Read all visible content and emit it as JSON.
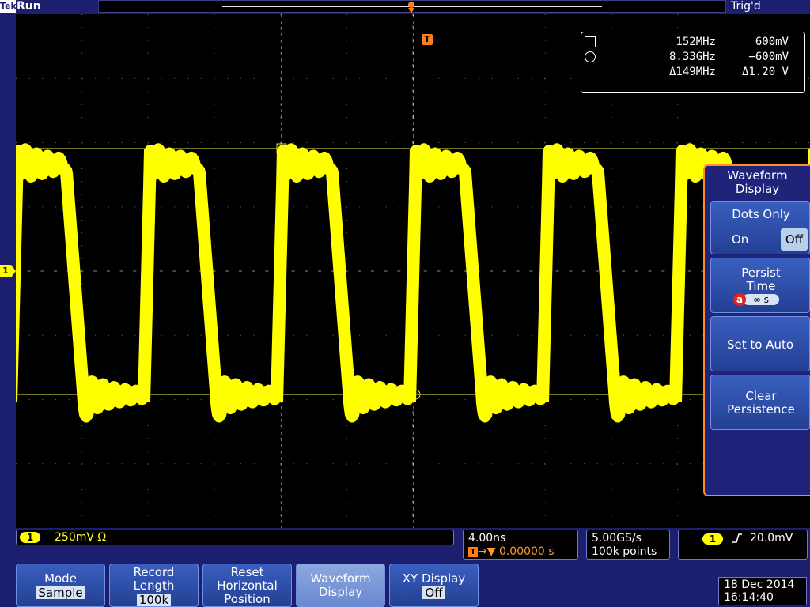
{
  "top": {
    "brand": "Tek",
    "run_status": "Run",
    "trigger_status": "Trig'd"
  },
  "graticule": {
    "trigger_marker": "T",
    "channel_marker": "1"
  },
  "cursor_readout": {
    "rows": [
      {
        "symbol": "square-icon",
        "freq": "152MHz",
        "volt": "600mV"
      },
      {
        "symbol": "circle-icon",
        "freq": "8.33GHz",
        "volt": "−600mV"
      },
      {
        "symbol": "",
        "freq": "Δ149MHz",
        "volt": "Δ1.20 V"
      }
    ]
  },
  "side_menu": {
    "title": "Waveform Display",
    "dots_only": {
      "label": "Dots Only",
      "on": "On",
      "off": "Off",
      "selected": "Off"
    },
    "persist_time": {
      "label": "Persist Time",
      "knob": "a",
      "value": "∞ s"
    },
    "set_to_auto": "Set to Auto",
    "clear_persistence": "Clear Persistence"
  },
  "readouts": {
    "channel": {
      "badge": "1",
      "scale": "250mV Ω"
    },
    "horizontal": {
      "time_per_div": "4.00ns",
      "delay_marker": "T",
      "delay": "→▼ 0.00000 s"
    },
    "acquisition": {
      "sample_rate": "5.00GS/s",
      "record_length": "100k points"
    },
    "trigger": {
      "badge": "1",
      "slope": "rising-edge-icon",
      "level": "20.0mV"
    }
  },
  "bottom_menu": {
    "mode": {
      "label": "Mode",
      "value": "Sample"
    },
    "record_length": {
      "label": "Record Length",
      "value": "100k"
    },
    "reset_horizontal": {
      "label": "Reset Horizontal Position"
    },
    "waveform_display": {
      "label": "Waveform Display"
    },
    "xy_display": {
      "label": "XY Display",
      "value": "Off"
    }
  },
  "datetime": {
    "date": "18 Dec 2014",
    "time": "16:14:40"
  },
  "colors": {
    "background": "#1b1f6e",
    "trace": "#ffff00",
    "trigger": "#ff7f1a",
    "menu_border": "#ff8c2a",
    "button": "#2f50ab"
  }
}
